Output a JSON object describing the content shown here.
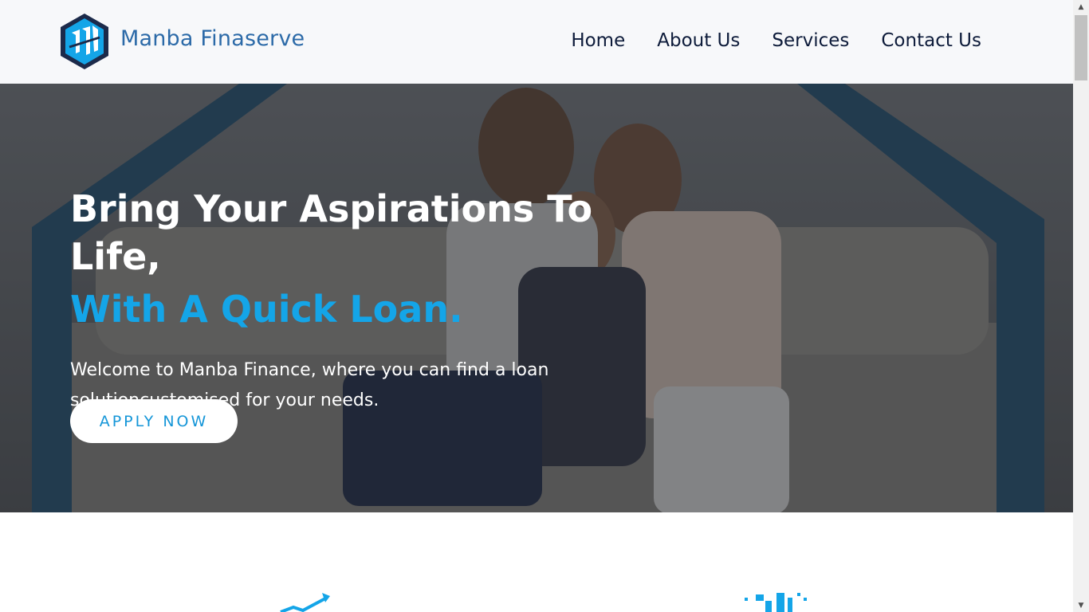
{
  "brand": {
    "name": "Manba Finaserve",
    "logo_icon": "manba-hexagon-logo"
  },
  "nav": {
    "items": [
      {
        "label": "Home"
      },
      {
        "label": "About Us"
      },
      {
        "label": "Services"
      },
      {
        "label": "Contact Us"
      }
    ]
  },
  "hero": {
    "title_line1": "Bring Your Aspirations To Life,",
    "title_line2": "With A Quick Loan.",
    "description": "Welcome to Manba Finance, where you can find a loan solutioncustomised for your needs.",
    "cta_label": "APPLY NOW",
    "background_image": "family-under-house-frame-photo"
  },
  "features": {
    "icons": [
      "growth-chart-icon",
      "city-money-bag-icon"
    ]
  },
  "colors": {
    "brand_blue": "#2c6aa8",
    "accent_blue": "#14a5e8",
    "nav_text": "#0d1b3a",
    "header_bg": "#f7f8fa"
  }
}
